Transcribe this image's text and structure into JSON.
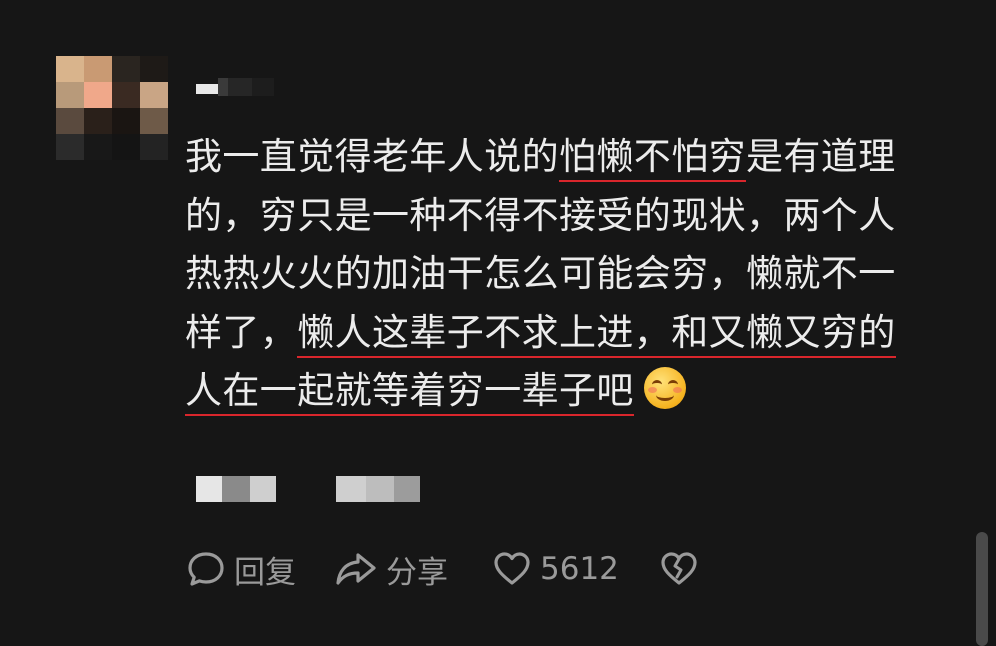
{
  "comment": {
    "lines": [
      [
        {
          "text": "我一直觉得老年人说的",
          "underline": false
        },
        {
          "text": "怕懒不怕穷",
          "underline": true
        },
        {
          "text": "是有道理",
          "underline": false
        }
      ],
      [
        {
          "text": "的，穷只是一种不得不接受的现状，两个人",
          "underline": false
        }
      ],
      [
        {
          "text": "热热火火的加油干怎么可能会穷，懒就不一",
          "underline": false
        }
      ],
      [
        {
          "text": "样了，",
          "underline": false
        },
        {
          "text": "懒人这辈子不求上进，和又懒又穷的",
          "underline": true
        }
      ],
      [
        {
          "text": "人在一起就等着穷一辈子吧",
          "underline": true
        }
      ]
    ],
    "emoji": "smiling-face-emoji"
  },
  "actions": {
    "reply_label": "回复",
    "share_label": "分享",
    "like_count": "5612"
  },
  "colors": {
    "background": "#161616",
    "text": "#ececec",
    "underline": "#d9262c",
    "action": "#9a9a9a"
  }
}
